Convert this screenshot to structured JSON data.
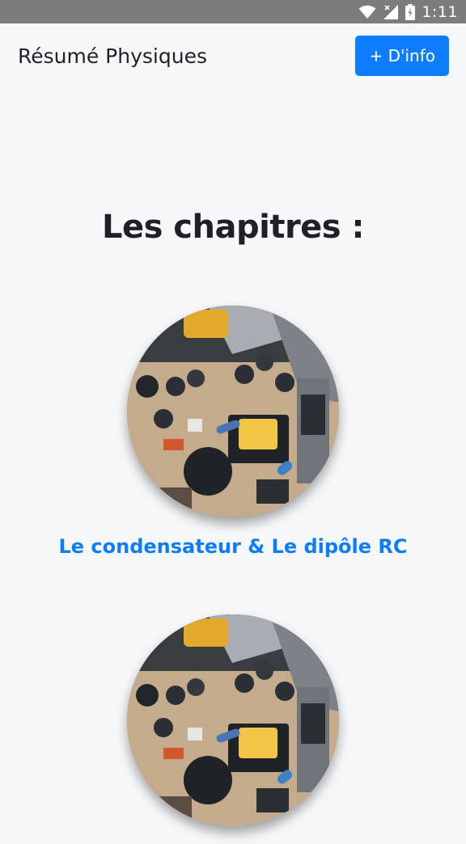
{
  "status_bar": {
    "time": "1:11",
    "icons": [
      "wifi-icon",
      "signal-icon",
      "battery-icon"
    ]
  },
  "app_bar": {
    "title": "Résumé Physiques",
    "info_button_label": "+ D'info"
  },
  "main": {
    "heading": "Les chapitres :",
    "chapters": [
      {
        "title": "Le condensateur & Le dipôle RC",
        "image": "circuit-board-photo"
      },
      {
        "title": "",
        "image": "circuit-board-photo"
      }
    ]
  },
  "colors": {
    "accent": "#0d7dfb",
    "status_bar": "#7c7c7c",
    "background": "#f6f7f9",
    "text": "#1f2328"
  }
}
